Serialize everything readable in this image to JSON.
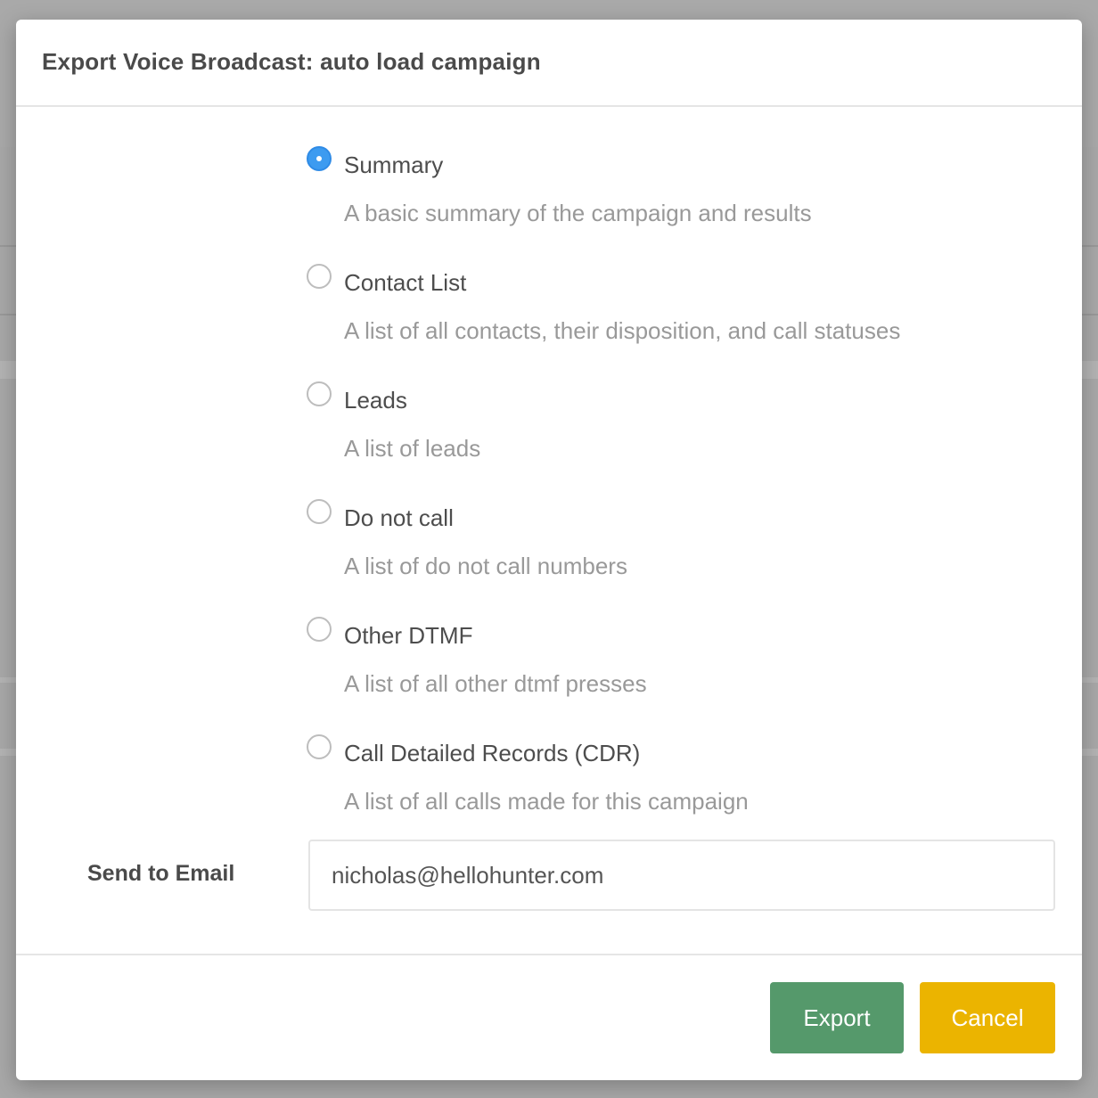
{
  "modal": {
    "title": "Export Voice Broadcast: auto load campaign"
  },
  "export_options": [
    {
      "label": "Summary",
      "description": "A basic summary of the campaign and results",
      "checked": true
    },
    {
      "label": "Contact List",
      "description": "A list of all contacts, their disposition, and call statuses",
      "checked": false
    },
    {
      "label": "Leads",
      "description": "A list of leads",
      "checked": false
    },
    {
      "label": "Do not call",
      "description": "A list of do not call numbers",
      "checked": false
    },
    {
      "label": "Other DTMF",
      "description": "A list of all other dtmf presses",
      "checked": false
    },
    {
      "label": "Call Detailed Records (CDR)",
      "description": "A list of all calls made for this campaign",
      "checked": false
    }
  ],
  "email": {
    "label": "Send to Email",
    "value": "nicholas@hellohunter.com"
  },
  "buttons": {
    "export_label": "Export",
    "cancel_label": "Cancel"
  },
  "colors": {
    "radio_selected": "#3d9bf0",
    "export_button": "#55996b",
    "cancel_button": "#ebb400"
  }
}
